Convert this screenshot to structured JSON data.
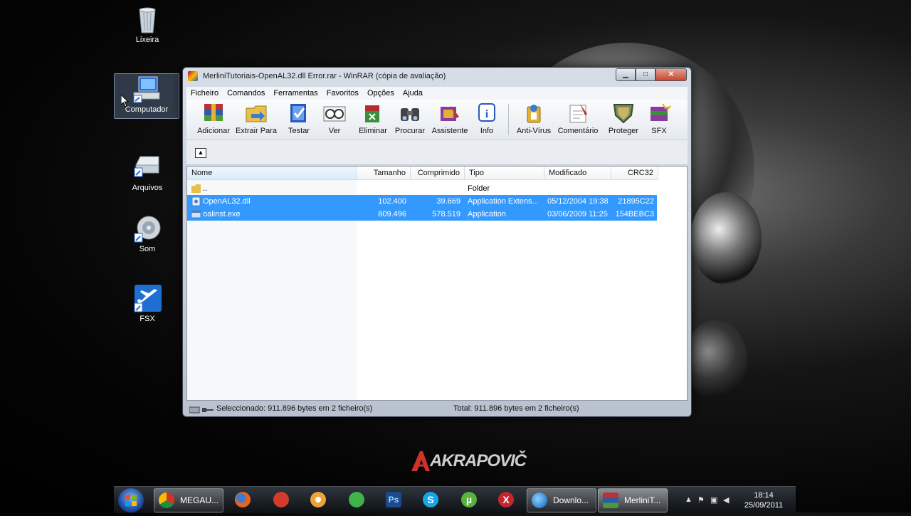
{
  "desktop": {
    "icons": [
      {
        "label": "Lixeira",
        "icon": "recycle-bin-icon"
      },
      {
        "label": "Computador",
        "icon": "computer-icon"
      },
      {
        "label": "Arquivos",
        "icon": "drive-icon"
      },
      {
        "label": "Som",
        "icon": "speaker-icon"
      },
      {
        "label": "FSX",
        "icon": "airplane-icon"
      }
    ],
    "brand": "AKRAPOVIČ"
  },
  "window": {
    "title": "MerliniTutoriais-OpenAL32.dll Error.rar - WinRAR (cópia de avaliação)",
    "controls": {
      "minimize": "▁",
      "maximize": "□",
      "close": "✕"
    },
    "menu": [
      "Ficheiro",
      "Comandos",
      "Ferramentas",
      "Favoritos",
      "Opções",
      "Ajuda"
    ],
    "toolbar": [
      {
        "label": "Adicionar",
        "icon": "add-archive-icon"
      },
      {
        "label": "Extrair Para",
        "icon": "extract-icon"
      },
      {
        "label": "Testar",
        "icon": "test-icon"
      },
      {
        "label": "Ver",
        "icon": "view-icon"
      },
      {
        "label": "Eliminar",
        "icon": "delete-icon"
      },
      {
        "label": "Procurar",
        "icon": "find-icon"
      },
      {
        "label": "Assistente",
        "icon": "wizard-icon"
      },
      {
        "label": "Info",
        "icon": "info-icon"
      },
      {
        "label": "Anti-Vírus",
        "icon": "antivirus-icon"
      },
      {
        "label": "Comentário",
        "icon": "comment-icon"
      },
      {
        "label": "Proteger",
        "icon": "protect-icon"
      },
      {
        "label": "SFX",
        "icon": "sfx-icon"
      }
    ],
    "columns": {
      "name": "Nome",
      "size": "Tamanho",
      "packed": "Comprimido",
      "type": "Tipo",
      "modified": "Modificado",
      "crc": "CRC32"
    },
    "rows": [
      {
        "name": "..",
        "size": "",
        "packed": "",
        "type": "Folder",
        "modified": "",
        "crc": "",
        "selected": false
      },
      {
        "name": "OpenAL32.dll",
        "size": "102.400",
        "packed": "39.669",
        "type": "Application Extens...",
        "modified": "05/12/2004 19:38",
        "crc": "21895C22",
        "selected": true
      },
      {
        "name": "oalinst.exe",
        "size": "809.496",
        "packed": "578.519",
        "type": "Application",
        "modified": "03/06/2009 11:25",
        "crc": "154BEBC3",
        "selected": true
      }
    ],
    "status": {
      "selected": "Seleccionado: 911.896 bytes em 2 ficheiro(s)",
      "total": "Total: 911.896 bytes em 2 ficheiro(s)"
    }
  },
  "taskbar": {
    "tasks": [
      {
        "label": "MEGAU...",
        "icon": "chrome-icon",
        "color": "#e8b22c"
      },
      {
        "label": "Downlo...",
        "icon": "globe-icon",
        "color": "#3a8fd6"
      },
      {
        "label": "MerliniT...",
        "icon": "winrar-icon",
        "color": "#8a3c9e"
      }
    ],
    "pinned": [
      {
        "icon": "firefox-icon",
        "color": "#e5651f"
      },
      {
        "icon": "game-icon",
        "color": "#d33c2a"
      },
      {
        "icon": "nero-icon",
        "color": "#f0a23a"
      },
      {
        "icon": "monster-icon",
        "color": "#3db34a"
      },
      {
        "icon": "photoshop-icon",
        "color": "#1c4a8a",
        "text": "Ps"
      },
      {
        "icon": "skype-icon",
        "color": "#1aa4e8",
        "text": "S"
      },
      {
        "icon": "utorrent-icon",
        "color": "#58b33c",
        "text": "µ"
      },
      {
        "icon": "app-x-icon",
        "color": "#c4262e",
        "text": "X"
      }
    ],
    "time": "18:14",
    "date": "25/09/2011"
  }
}
